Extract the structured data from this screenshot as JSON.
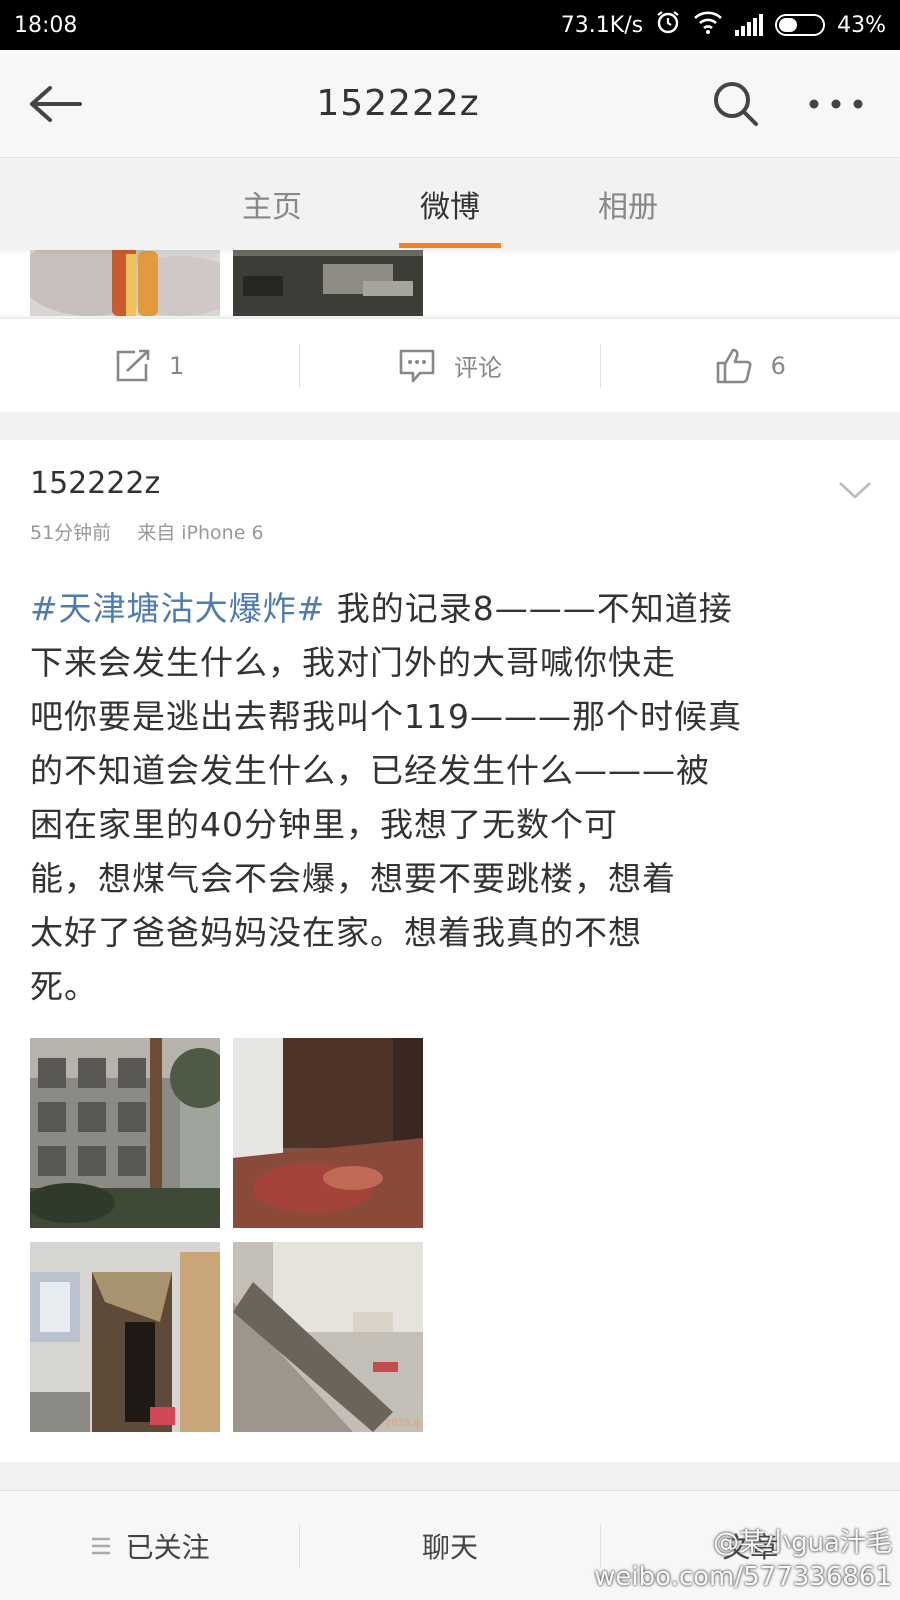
{
  "status_bar": {
    "time": "18:08",
    "network_speed": "73.1K/s",
    "battery": "43%",
    "battery_level": 0.43
  },
  "nav": {
    "title": "152222z"
  },
  "tabs": [
    {
      "label": "主页",
      "active": false
    },
    {
      "label": "微博",
      "active": true
    },
    {
      "label": "相册",
      "active": false
    }
  ],
  "actions": {
    "repost_count": "1",
    "comment_label": "评论",
    "like_count": "6"
  },
  "post": {
    "author": "152222z",
    "time_ago": "51分钟前",
    "source": "来自 iPhone 6",
    "hashtag": "#天津塘沽大爆炸#",
    "text_lines": [
      " 我的记录8———不知道接",
      "下来会发生什么，我对门外的大哥喊你快走",
      "吧你要是逃出去帮我叫个119———那个时候真",
      "的不知道会发生什么，已经发生什么———被",
      "困在家里的40分钟里，我想了无数个可",
      "能，想煤气会不会爆，想要不要跳楼，想着",
      "太好了爸爸妈妈没在家。想着我真的不想",
      "死。"
    ],
    "photo_date": "2015.8"
  },
  "bottom_bar": {
    "follow": "已关注",
    "chat": "聊天",
    "article": "文章"
  },
  "watermark": {
    "handle": "@某小gua汁毛",
    "url": "weibo.com/577336861"
  },
  "colors": {
    "accent": "#f5821f",
    "hashtag": "#4d7cb3"
  }
}
